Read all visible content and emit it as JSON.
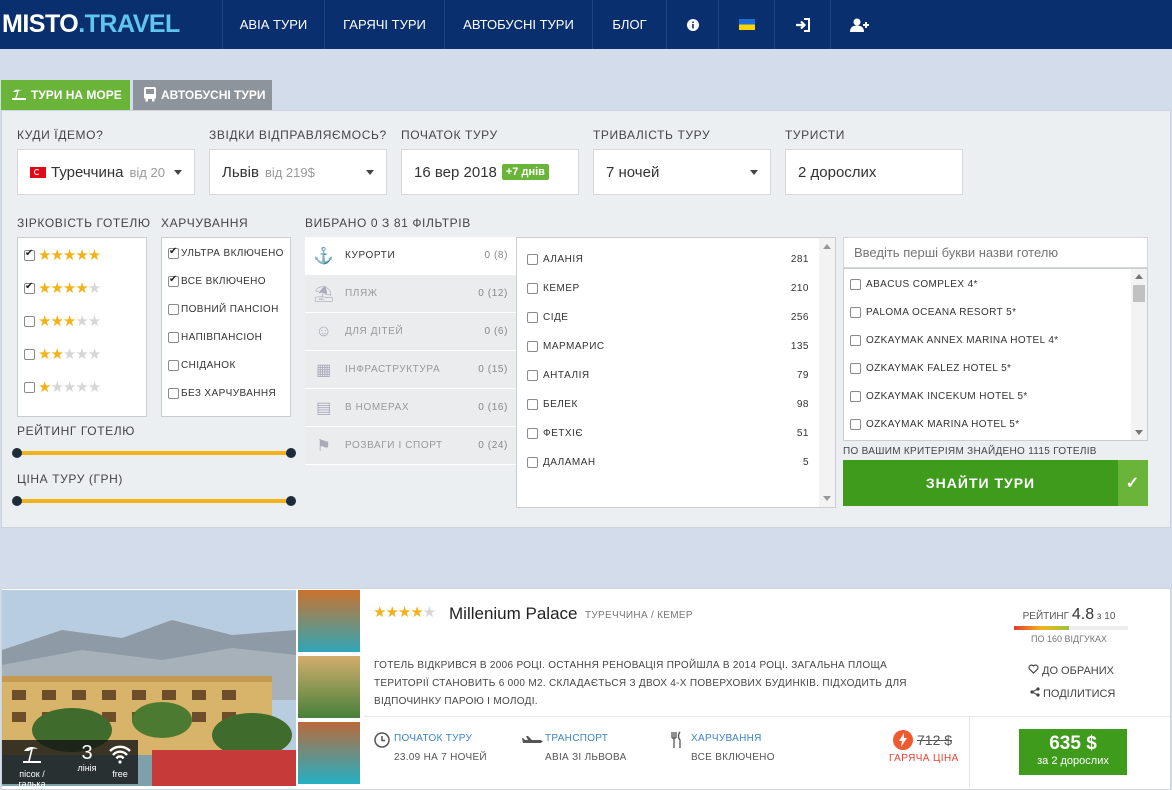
{
  "header": {
    "logo_a": "MISTO",
    "logo_b": ".TRAVEL",
    "nav": [
      "АВІА ТУРИ",
      "ГАРЯЧІ ТУРИ",
      "АВТОБУСНІ ТУРИ",
      "БЛОГ"
    ],
    "icons": [
      "info-icon",
      "ukraine-flag-icon",
      "login-icon",
      "add-user-icon"
    ]
  },
  "tabs": {
    "sea": "ТУРИ НА МОРЕ",
    "bus": "АВТОБУСНІ ТУРИ"
  },
  "search": {
    "where_label": "КУДИ ЇДЕМО?",
    "where_value": "Туреччина",
    "where_from": "від 20",
    "from_label": "ЗВІДКИ ВІДПРАВЛЯЄМОСЬ?",
    "from_value": "Львів",
    "from_price": "від 219$",
    "start_label": "ПОЧАТОК ТУРУ",
    "start_value": "16 вер 2018",
    "start_badge": "+7 днів",
    "dur_label": "ТРИВАЛІСТЬ ТУРУ",
    "dur_value": "7 ночей",
    "tourists_label": "ТУРИСТИ",
    "tourists_value": "2 дорослих"
  },
  "stars_label": "ЗІРКОВІСТЬ ГОТЕЛЮ",
  "stars": [
    {
      "n": 5,
      "checked": true
    },
    {
      "n": 4,
      "checked": true
    },
    {
      "n": 3,
      "checked": false
    },
    {
      "n": 2,
      "checked": false
    },
    {
      "n": 1,
      "checked": false
    }
  ],
  "food_label": "ХАРЧУВАННЯ",
  "food": [
    {
      "label": "УЛЬТРА ВКЛЮЧЕНО",
      "checked": true
    },
    {
      "label": "ВСЕ ВКЛЮЧЕНО",
      "checked": true
    },
    {
      "label": "ПОВНИЙ ПАНСІОН",
      "checked": false
    },
    {
      "label": "НАПІВПАНСІОН",
      "checked": false
    },
    {
      "label": "СНІДАНОК",
      "checked": false
    },
    {
      "label": "БЕЗ ХАРЧУВАННЯ",
      "checked": false
    }
  ],
  "rating_label": "РЕЙТИНГ ГОТЕЛЮ",
  "price_label": "ЦІНА ТУРУ (ГРН)",
  "filters_label": "ВИБРАНО 0 З 81 ФІЛЬТРІВ",
  "filter_tabs": [
    {
      "label": "КУРОРТИ",
      "count": "0 (8)",
      "icon": "anchor-icon"
    },
    {
      "label": "ПЛЯЖ",
      "count": "0 (12)",
      "icon": "beach-icon"
    },
    {
      "label": "ДЛЯ ДІТЕЙ",
      "count": "0 (6)",
      "icon": "child-icon"
    },
    {
      "label": "ІНФРАСТРУКТУРА",
      "count": "0 (15)",
      "icon": "buildings-icon"
    },
    {
      "label": "В НОМЕРАХ",
      "count": "0 (16)",
      "icon": "room-icon"
    },
    {
      "label": "РОЗВАГИ І СПОРТ",
      "count": "0 (24)",
      "icon": "sport-icon"
    }
  ],
  "resorts": [
    {
      "name": "АЛАНІЯ",
      "count": "281"
    },
    {
      "name": "КЕМЕР",
      "count": "210"
    },
    {
      "name": "СІДЕ",
      "count": "256"
    },
    {
      "name": "МАРМАРИС",
      "count": "135"
    },
    {
      "name": "АНТАЛІЯ",
      "count": "79"
    },
    {
      "name": "БЕЛЕК",
      "count": "98"
    },
    {
      "name": "ФЕТХІЄ",
      "count": "51"
    },
    {
      "name": "ДАЛАМАН",
      "count": "5"
    }
  ],
  "hotel_search_placeholder": "Введіть перші букви назви готелю",
  "hotels": [
    "ABACUS COMPLEX 4*",
    "PALOMA OCEANA RESORT 5*",
    "OZKAYMAK ANNEX MARINA HOTEL 4*",
    "OZKAYMAK FALEZ HOTEL 5*",
    "OZKAYMAK INCEKUM HOTEL 5*",
    "OZKAYMAK MARINA HOTEL 5*"
  ],
  "found_text": "ПО ВАШИМ КРИТЕРІЯМ ЗНАЙДЕНО 1115 ГОТЕЛІВ",
  "find_button": "ЗНАЙТИ ТУРИ",
  "card": {
    "stars": 4,
    "name": "Millenium Palace",
    "location": "ТУРЕЧЧИНА / КЕМЕР",
    "description": "ГОТЕЛЬ ВІДКРИВСЯ В 2006 РОЦІ. ОСТАННЯ РЕНОВАЦІЯ ПРОЙШЛА В 2014 РОЦІ. ЗАГАЛЬНА ПЛОЩА ТЕРИТОРІЇ СТАНОВИТЬ 6 000 М2. СКЛАДАЄТЬСЯ З ДВОХ 4-Х ПОВЕРХОВИХ БУДИНКІВ. ПІДХОДИТЬ ДЛЯ ВІДПОЧИНКУ ПАРОЮ І МОЛОДІ.",
    "rating_label": "РЕЙТИНГ",
    "rating": "4.8",
    "rating_of": "з 10",
    "reviews": "ПО 160 ВІДГУКАХ",
    "rating_fraction": 0.48,
    "fav": "ДО ОБРАНИХ",
    "share": "ПОДІЛИТИСЯ",
    "start_cap": "ПОЧАТОК ТУРУ",
    "start_val": "23.09 НА 7 НОЧЕЙ",
    "transport_cap": "ТРАНСПОРТ",
    "transport_val": "АВІА ЗІ ЛЬВОВА",
    "food_cap": "ХАРЧУВАННЯ",
    "food_val": "ВСЕ ВКЛЮЧЕНО",
    "old_price": "712 $",
    "hot_label": "ГАРЯЧА ЦІНА",
    "price": "635 $",
    "price_sub": "за 2 дорослих",
    "beach_tag": "пісок / галька",
    "line_num": "3",
    "line_tag": "лінія",
    "wifi_tag": "free"
  }
}
